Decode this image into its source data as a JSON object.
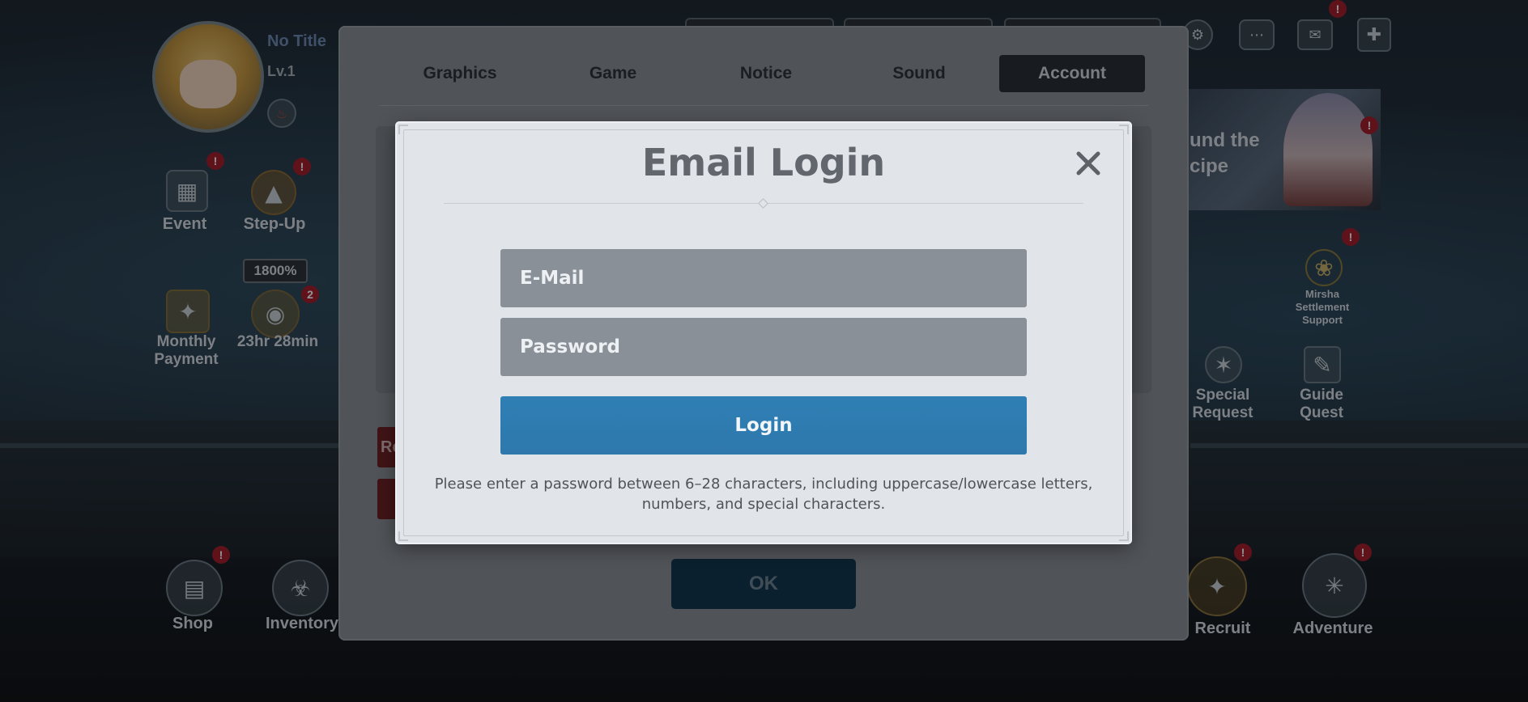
{
  "colors": {
    "modal_background": "#e1e4e9",
    "field_background": "#8a9098",
    "login_button": "#2e7bb0",
    "active_tab": "#2a2f36",
    "ok_button": "#143850",
    "badge": "#a52030"
  },
  "hud": {
    "player_title": "No Title",
    "player_level": "Lv.1",
    "event_label": "Event",
    "stepup_label": "Step-Up",
    "bonus_badge": "1800%",
    "monthly_label": "Monthly\nPayment",
    "timer_label": "23hr 28min",
    "timer_badge": "2",
    "shop_label": "Shop",
    "inventory_label": "Inventory",
    "recruit_label": "Recruit",
    "adventure_label": "Adventure",
    "banner_text": "und the\ncipe",
    "mirsha_label": "Mirsha\nSettlement\nSupport",
    "special_request_label": "Special\nRequest",
    "guide_quest_label": "Guide\nQuest",
    "alert_badge": "!",
    "icons": [
      "event-icon",
      "stepup-icon",
      "monthly-payment-icon",
      "shop-icon",
      "inventory-lock-icon",
      "recruit-icon",
      "adventure-compass-icon",
      "chat-icon",
      "mail-icon",
      "menu-grid-icon",
      "settings-gear-icon"
    ]
  },
  "settings": {
    "tabs": [
      {
        "label": "Graphics",
        "active": false
      },
      {
        "label": "Game",
        "active": false
      },
      {
        "label": "Notice",
        "active": false
      },
      {
        "label": "Sound",
        "active": false
      },
      {
        "label": "Account",
        "active": true
      }
    ],
    "red_button_stub": "Re",
    "ok_label": "OK"
  },
  "modal": {
    "title": "Email Login",
    "close_icon": "close-icon",
    "email_placeholder": "E-Mail",
    "password_placeholder": "Password",
    "login_label": "Login",
    "hint": "Please enter a password between 6–28 characters, including uppercase/lowercase letters, numbers, and special characters."
  }
}
